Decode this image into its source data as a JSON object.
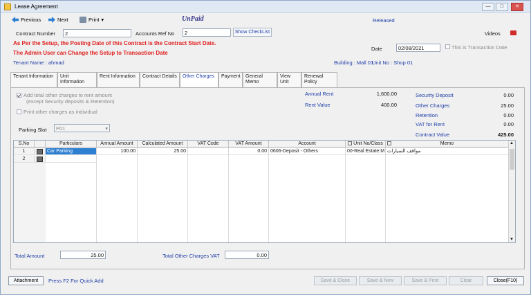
{
  "window": {
    "title": "Lease Agreement",
    "min": "—",
    "max": "□",
    "close": "✕"
  },
  "toolbar": {
    "previous": "Previous",
    "next": "Next",
    "print": "Print",
    "print_caret": "▾"
  },
  "status": {
    "paid_state": "UnPaid",
    "released": "Released"
  },
  "header": {
    "contract_number_label": "Contract Number",
    "contract_number": "2",
    "accounts_ref_label": "Accounts Ref No",
    "accounts_ref": "2",
    "show_checklist": "Show CheckList",
    "videos_label": "Videos",
    "warning1": "As Per the Setup, the Posting Date of this Contract is the Contract Start Date.",
    "warning2": "The Admin User can Change the Setup to Transaction Date",
    "date_label": "Date",
    "date": "02/08/2021",
    "transaction_date_label": "This is Transaction Date",
    "tenant_name": "Tenant Name : ahmad",
    "building": "Building : Mall 01",
    "unit_no": "Unit No : Shop 01"
  },
  "tabs": [
    {
      "label": "Tenant Information",
      "width": 68
    },
    {
      "label": "Unit Information",
      "width": 57
    },
    {
      "label": "Rent Information",
      "width": 62
    },
    {
      "label": "Contract Details",
      "width": 58
    },
    {
      "label": "Other Charges",
      "width": 56,
      "active": true
    },
    {
      "label": "Payment",
      "width": 35
    },
    {
      "label": "General Memo",
      "width": 50
    },
    {
      "label": "View Unit",
      "width": 35
    },
    {
      "label": "Renewal Policy",
      "width": 52
    }
  ],
  "options": {
    "add_charges_line1": "Add total other charges to rent amount",
    "add_charges_line2": "(except Security deposits  & Retention)",
    "print_individual": "Print other charges as individual",
    "parking_slot_label": "Parking Slot",
    "parking_slot_value": "P01"
  },
  "summary": {
    "annual_rent_label": "Annual Rent",
    "annual_rent": "1,600.00",
    "rent_value_label": "Rent Value",
    "rent_value": "400.00",
    "security_deposit_label": "Security Deposit",
    "security_deposit": "0.00",
    "other_charges_label": "Other Charges",
    "other_charges": "25.00",
    "retention_label": "Retention",
    "retention": "0.00",
    "vat_rent_label": "VAT for Rent",
    "vat_rent": "0.00",
    "contract_value_label": "Contract Value",
    "contract_value": "425.00"
  },
  "grid": {
    "headers": [
      "S.No",
      "",
      "Particulars",
      "Annual Amount",
      "Calculated Amount",
      "VAT Code",
      "VAT Amount",
      "Account",
      "Unit No/Class",
      "Memo"
    ],
    "rows": [
      {
        "sno": "1",
        "particulars": "Car Parking",
        "annual": "100.00",
        "calculated": "25.00",
        "vat_code": "",
        "vat_amount": "0.00",
        "account": "0606-Deposit -  Others",
        "unit": "00-Real Estate:M",
        "memo": "مواقف السيارات"
      },
      {
        "sno": "2",
        "particulars": "",
        "annual": "",
        "calculated": "",
        "vat_code": "",
        "vat_amount": "",
        "account": "",
        "unit": "",
        "memo": ""
      }
    ]
  },
  "totals": {
    "total_amount_label": "Total Amount",
    "total_amount": "25.00",
    "total_vat_label": "Total Other Charges VAT",
    "total_vat": "0.00"
  },
  "footer": {
    "attachment": "Attachment",
    "quick_add_hint": "Press F2 For Quick Add",
    "save_close": "Save & Close",
    "save_new": "Save & New",
    "save_print": "Save & Print",
    "clear": "Clear",
    "close": "Close(F10)"
  }
}
